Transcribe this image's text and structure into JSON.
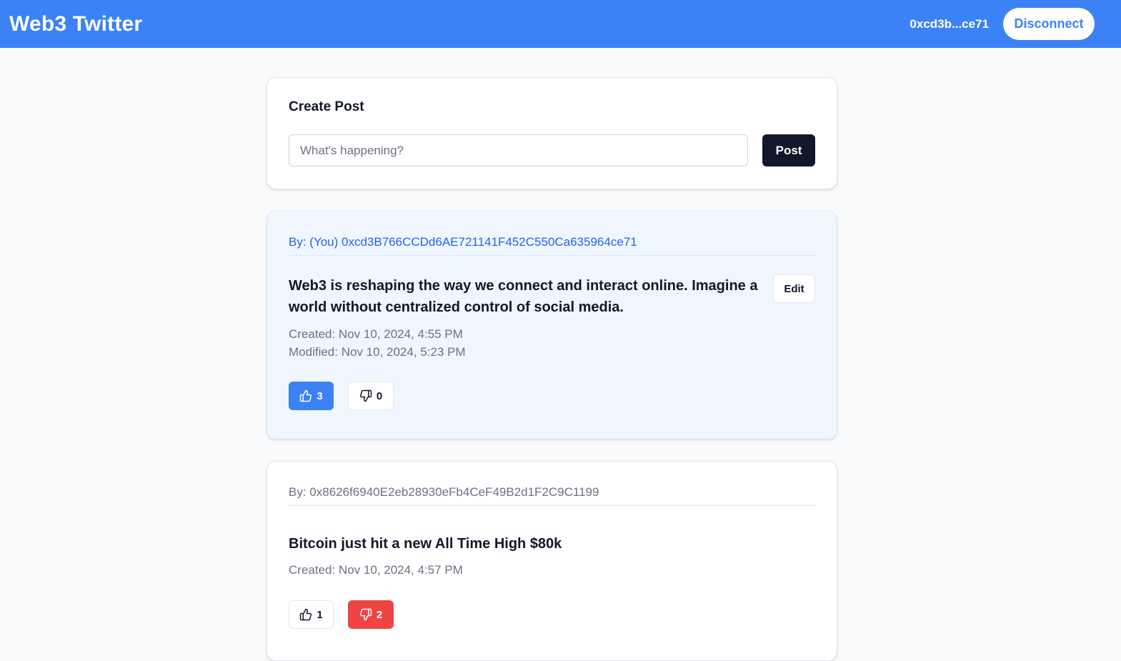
{
  "header": {
    "title": "Web3 Twitter",
    "wallet_short": "0xcd3b...ce71",
    "disconnect_label": "Disconnect",
    "color": "#3b82f6"
  },
  "create_post": {
    "title": "Create Post",
    "placeholder": "What's happening?",
    "value": "",
    "post_label": "Post"
  },
  "posts": [
    {
      "author": "By: (You) 0xcd3B766CCDd6AE721141F452C550Ca635964ce71",
      "content": "Web3 is reshaping the way we connect and interact online. Imagine a world without centralized control of social media.",
      "edit_label": "Edit",
      "created": "Created: Nov 10, 2024, 4:55 PM",
      "modified": "Modified: Nov 10, 2024, 5:23 PM",
      "likes": "3",
      "dislikes": "0",
      "liked": true,
      "disliked": false,
      "like_icon": "thumbs-up-icon",
      "dislike_icon": "thumbs-down-icon"
    },
    {
      "author": "By: 0x8626f6940E2eb28930eFb4CeF49B2d1F2C9C1199",
      "content": "Bitcoin just hit a new All Time High $80k",
      "created": "Created: Nov 10, 2024, 4:57 PM",
      "likes": "1",
      "dislikes": "2",
      "liked": false,
      "disliked": true,
      "like_icon": "thumbs-up-icon",
      "dislike_icon": "thumbs-down-icon"
    }
  ],
  "colors": {
    "accent": "#3b82f6",
    "dislike_active": "#ef4444",
    "own_post_bg": "#eff6ff",
    "dark_button": "#111827"
  }
}
